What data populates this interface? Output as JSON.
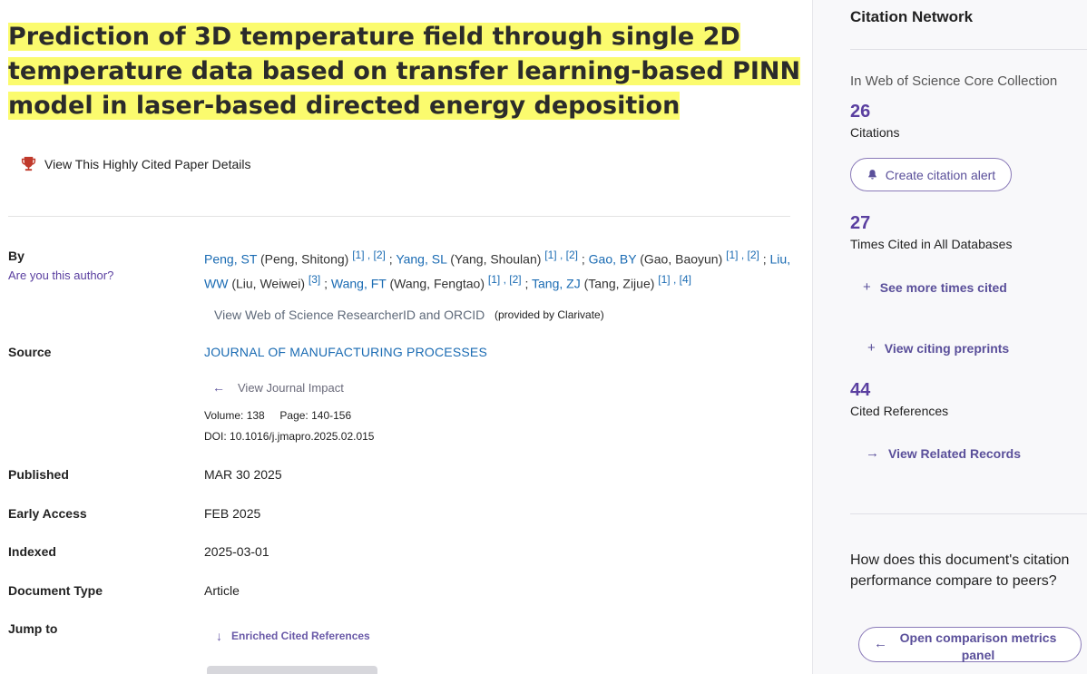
{
  "title": "Prediction of 3D temperature field through single 2D temperature data based on transfer learning-based PINN model in laser-based directed energy deposition",
  "highly_cited_link": "View This Highly Cited Paper Details",
  "labels": {
    "by": "By",
    "are_you_author": "Are you this author?",
    "source": "Source",
    "published": "Published",
    "early_access": "Early Access",
    "indexed": "Indexed",
    "document_type": "Document Type",
    "jump_to": "Jump to"
  },
  "authors": [
    {
      "short": "Peng, ST",
      "full": "(Peng, Shitong)",
      "refs": "[1] , [2]"
    },
    {
      "short": "Yang, SL",
      "full": "(Yang, Shoulan)",
      "refs": "[1] , [2]"
    },
    {
      "short": "Gao, BY",
      "full": "(Gao, Baoyun)",
      "refs": "[1] , [2]"
    },
    {
      "short": "Liu, WW",
      "full": "(Liu, Weiwei)",
      "refs": "[3]"
    },
    {
      "short": "Wang, FT",
      "full": "(Wang, Fengtao)",
      "refs": "[1] , [2]"
    },
    {
      "short": "Tang, ZJ",
      "full": "(Tang, Zijue)",
      "refs": "[1] , [4]"
    }
  ],
  "researcher_id_link": "View Web of Science ResearcherID and ORCID",
  "provided_by": "(provided by Clarivate)",
  "source": {
    "journal": "JOURNAL OF MANUFACTURING PROCESSES",
    "journal_impact_link": "View Journal Impact",
    "volume_label": "Volume:",
    "volume": "138",
    "page_label": "Page:",
    "pages": "140-156",
    "doi_label": "DOI:",
    "doi": "10.1016/j.jmapro.2025.02.015"
  },
  "published": "MAR 30 2025",
  "early_access": "FEB 2025",
  "indexed": "2025-03-01",
  "document_type": "Article",
  "jump_to_link": "Enriched Cited References",
  "sidebar": {
    "title": "Citation Network",
    "collection": "In Web of Science Core Collection",
    "citations": "26",
    "citations_label": "Citations",
    "alert_button": "Create citation alert",
    "times_cited_all": "27",
    "times_cited_all_label": "Times Cited in All Databases",
    "see_more_link": "See more times cited",
    "citing_preprints_link": "View citing preprints",
    "cited_references": "44",
    "cited_references_label": "Cited References",
    "related_records_link": "View Related Records",
    "question": "How does this document's citation performance compare to peers?",
    "compare_button": "Open comparison metrics panel"
  },
  "colors": {
    "highlight": "#fbfb6e",
    "link_blue": "#1a6bb3",
    "accent_purple": "#5a3fa0",
    "trophy": "#c0392b"
  }
}
